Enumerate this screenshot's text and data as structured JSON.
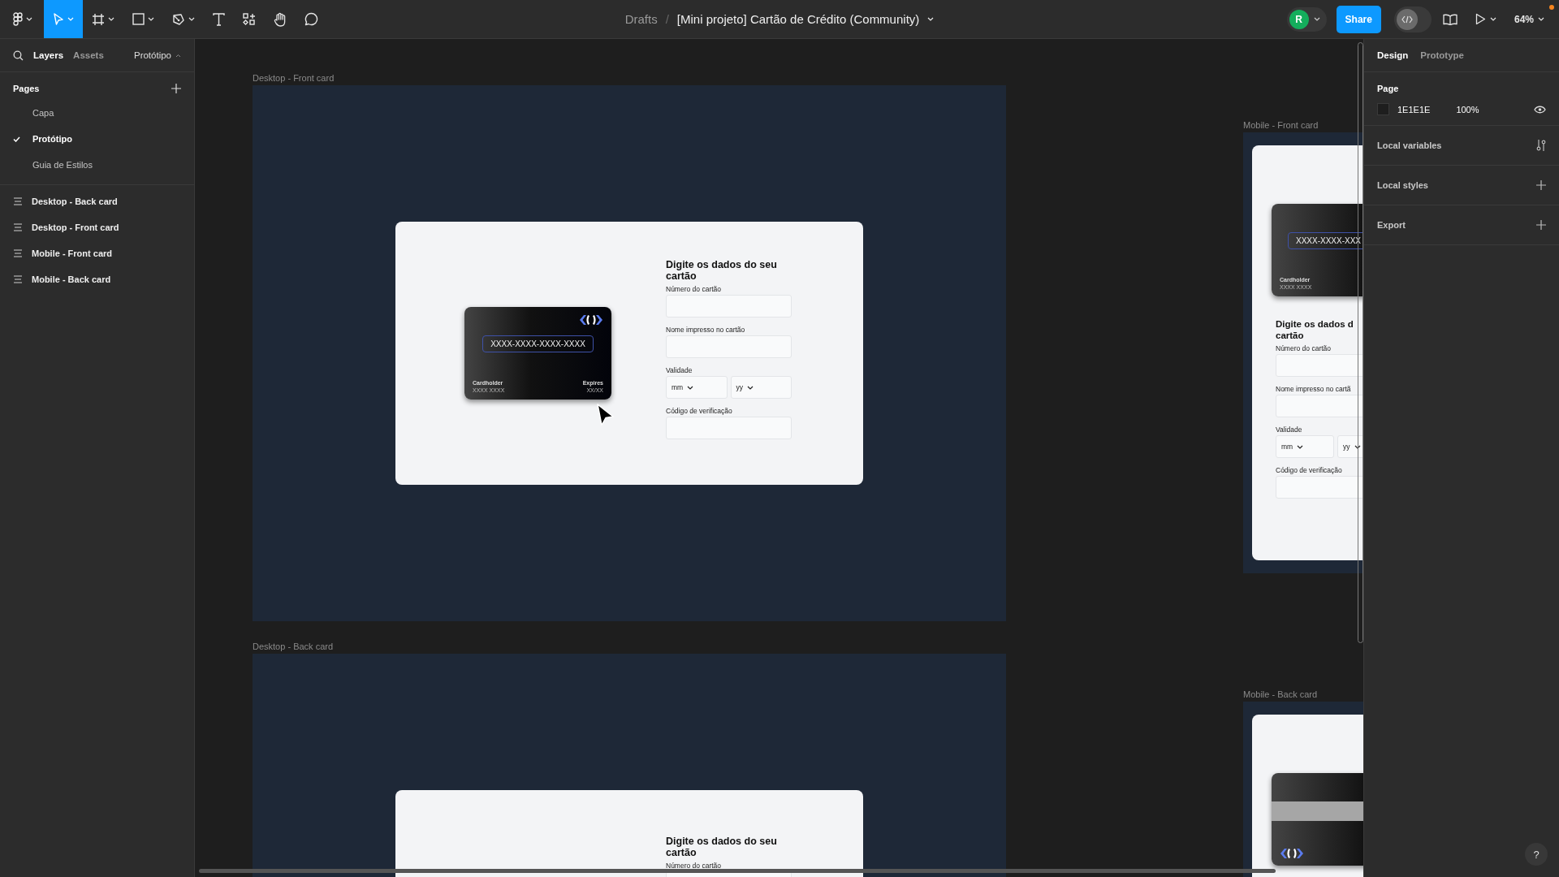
{
  "toolbar": {
    "tools": [
      {
        "kind": "main-menu",
        "selected": false
      },
      {
        "kind": "move",
        "selected": true
      },
      {
        "kind": "frame",
        "selected": false
      },
      {
        "kind": "shape",
        "selected": false
      },
      {
        "kind": "pen",
        "selected": false
      },
      {
        "kind": "text",
        "selected": false
      },
      {
        "kind": "actions",
        "selected": false
      },
      {
        "kind": "hand",
        "selected": false
      },
      {
        "kind": "comment",
        "selected": false
      }
    ],
    "breadcrumb": "Drafts",
    "separator": "/",
    "file_title": "[Mini projeto] Cartão de Crédito (Community)",
    "avatar": "R",
    "share": "Share",
    "zoom": "64%"
  },
  "left_panel": {
    "tabs": [
      {
        "label": "Layers",
        "selected": true
      },
      {
        "label": "Assets",
        "selected": false
      }
    ],
    "page_switcher": "Protótipo",
    "pages_heading": "Pages",
    "pages": [
      {
        "label": "Capa",
        "selected": false
      },
      {
        "label": "Protótipo",
        "selected": true
      },
      {
        "label": "Guia de Estilos",
        "selected": false
      }
    ],
    "layers": [
      "Desktop - Back card",
      "Desktop - Front card",
      "Mobile - Front card",
      "Mobile - Back card"
    ]
  },
  "canvas": {
    "frames": [
      {
        "kind": "desktop",
        "label": "Desktop - Front card",
        "card": {
          "kind": "front",
          "logo": true,
          "number": "XXXX-XXXX-XXXX-XXXX",
          "holder_label": "Cardholder",
          "holder": "XXXX XXXX",
          "expires_label": "Expires",
          "expires": "XX/XX"
        },
        "form": {
          "title_lines": [
            "Digite os dados do seu",
            "cartão"
          ],
          "fields": [
            {
              "kind": "text",
              "label": "Número do cartão"
            },
            {
              "kind": "text",
              "label": "Nome impresso no cartão"
            },
            {
              "kind": "date",
              "label": "Validade",
              "month": "mm",
              "year": "yy"
            },
            {
              "kind": "text",
              "label": "Código de verificação"
            }
          ]
        }
      },
      {
        "kind": "desktop-back",
        "label": "Desktop - Back card",
        "form": {
          "title_lines": [
            "Digite os dados do seu",
            "cartão"
          ],
          "fields": [
            {
              "kind": "text",
              "label": "Número do cartão"
            }
          ]
        }
      },
      {
        "kind": "mobile",
        "label": "Mobile - Front card",
        "card": {
          "kind": "front",
          "number": "XXXX-XXXX-XXX",
          "holder_label": "Cardholder",
          "holder": "XXXX XXXX"
        },
        "form": {
          "title_lines": [
            "Digite os dados d",
            "cartão"
          ],
          "fields": [
            {
              "kind": "text",
              "label": "Número do cartão"
            },
            {
              "kind": "text",
              "label": "Nome impresso no cartã"
            },
            {
              "kind": "date",
              "label": "Validade",
              "month": "mm",
              "year": "yy"
            },
            {
              "kind": "text",
              "label": "Código de verificação"
            }
          ]
        }
      },
      {
        "kind": "mobile-back",
        "label": "Mobile - Back card",
        "card": {
          "kind": "back",
          "logo": true
        }
      }
    ]
  },
  "right_panel": {
    "tabs": [
      {
        "label": "Design",
        "selected": true
      },
      {
        "label": "Prototype",
        "selected": false
      }
    ],
    "page_heading": "Page",
    "page_color": "1E1E1E",
    "page_opacity": "100%",
    "sections": [
      {
        "label": "Local variables",
        "kind": "variables"
      },
      {
        "label": "Local styles",
        "kind": "add"
      },
      {
        "label": "Export",
        "kind": "add"
      }
    ],
    "help": "?"
  }
}
